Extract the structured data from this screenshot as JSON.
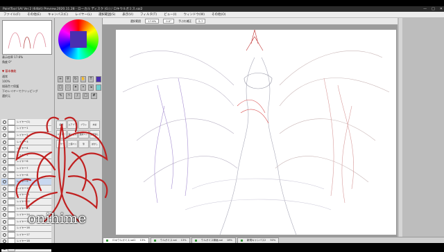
{
  "titlebar": {
    "text": "PaintTool SAI Ver.2 (64bit) Preview.2020.11.28 - ローカル ディスク (G:) / ロキウルガミス.sai2"
  },
  "menu": [
    "ファイル(F)",
    "その他(E)",
    "キャンバス(C)",
    "レイヤー(L)",
    "選択範囲(S)",
    "表示(V)",
    "フィルタ(T)",
    "ビュー(I)",
    "ウィンドウ(W)",
    "その他(O)"
  ],
  "navigator": {
    "zoom": "17.6%",
    "angle": "0°"
  },
  "panels": {
    "layer_header": "▼ 基本機能",
    "mode": "通常",
    "opacity": "100%",
    "protect": "描画色で保護",
    "clip": "下のレイヤーでクリッピング",
    "select_src": "選択元"
  },
  "layers": [
    "レイヤー(1)",
    "レイヤー1",
    "レイヤー2",
    "レイヤー3",
    "レイヤー4",
    "レイヤー5",
    "レイヤー6",
    "レイヤー7",
    "レイヤー8",
    "レイヤー9",
    "レイヤー10",
    "レイヤー11",
    "レイヤー12",
    "レイヤー13",
    "レイヤー14",
    "レイヤー15",
    "レイヤー16",
    "レイヤー17",
    "レイヤー18",
    "レイヤー19"
  ],
  "brushes": [
    "鉛筆",
    "エアブラシ",
    "ブラシ",
    "水彩",
    "マーカー",
    "消しゴム",
    "選択ペン",
    "選択消し",
    "バケツ",
    "二値ペン",
    "筆",
    "ぼかし"
  ],
  "canvas_toolbar": {
    "select_label": "選択範囲",
    "zoom": "17.6%",
    "angle": "0.0°",
    "stabilizer_label": "手ぶれ補正",
    "stabilizer": "S-7"
  },
  "tabs": [
    "ロキウルガミス.sai2",
    "ウルガミス.sai",
    "ウルガミス線画.sai",
    "新規キャンバス2"
  ],
  "tab_pct": [
    "13%",
    "13%",
    "18%",
    "50%"
  ],
  "watermark": "onihime",
  "colors": {
    "accent": "#4a2fb0",
    "watermark_red": "#c02020"
  }
}
